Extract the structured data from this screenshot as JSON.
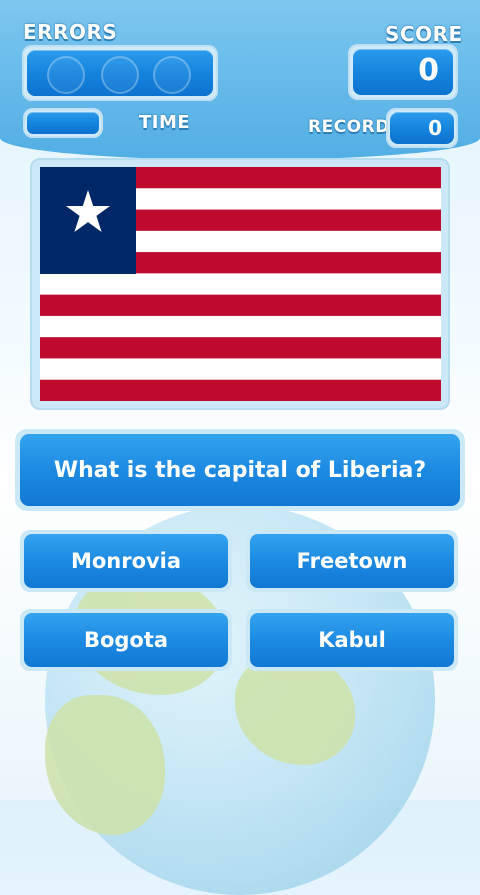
{
  "hud": {
    "errors_label": "ERRORS",
    "score_label": "SCORE",
    "score_value": "0",
    "time_label": "TIME",
    "record_label": "RECORD",
    "record_value": "0",
    "error_slots": 3,
    "errors_used": 0
  },
  "flag": {
    "country": "Liberia",
    "colors": {
      "red": "#bf0a30",
      "white": "#ffffff",
      "blue": "#002868"
    },
    "stripes": 11
  },
  "question": {
    "text": "What is the capital of Liberia?"
  },
  "answers": [
    "Monrovia",
    "Freetown",
    "Bogota",
    "Kabul"
  ],
  "colors": {
    "header": "#5ab4e8",
    "button": "#1684de",
    "panel": "#cbe8f7"
  }
}
